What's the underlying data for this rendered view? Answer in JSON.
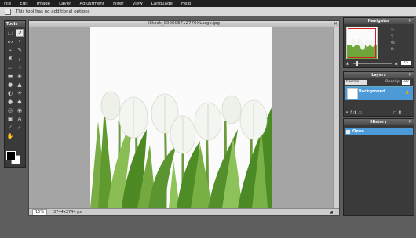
{
  "menu": [
    "File",
    "Edit",
    "Image",
    "Layer",
    "Adjustment",
    "Filter",
    "View",
    "Language",
    "Help"
  ],
  "options_bar": {
    "message": "This tool has no additional options"
  },
  "tools": {
    "title": "Tools",
    "icons": [
      "marquee-icon",
      "move-icon",
      "lasso-icon",
      "wand-icon",
      "crop-icon",
      "pencil-icon",
      "stamp-icon",
      "brush-icon",
      "eraser-icon",
      "smudge-icon",
      "gradient-icon",
      "fill-icon",
      "blur-icon",
      "sharpen-icon",
      "dodge-icon",
      "burn-icon",
      "sponge-icon",
      "replace-icon",
      "redeye-icon",
      "spot-heal-icon",
      "shape-icon",
      "text-icon",
      "eyedropper-icon",
      "zoom-icon",
      "hand-icon"
    ]
  },
  "image": {
    "title": "iStock_000008712770XLarge.jpg",
    "zoom": "15%",
    "dimensions": "3744x3744 px"
  },
  "navigator": {
    "title": "Navigator",
    "x": "X:",
    "y": "Y:",
    "w": "W:",
    "h": "H:",
    "zoom": "15"
  },
  "layers": {
    "title": "Layers",
    "blend_mode": "Normal",
    "opacity_label": "Opacity:",
    "opacity_value": "100",
    "layer_name": "Background"
  },
  "history": {
    "title": "History",
    "items": [
      "Open"
    ]
  }
}
